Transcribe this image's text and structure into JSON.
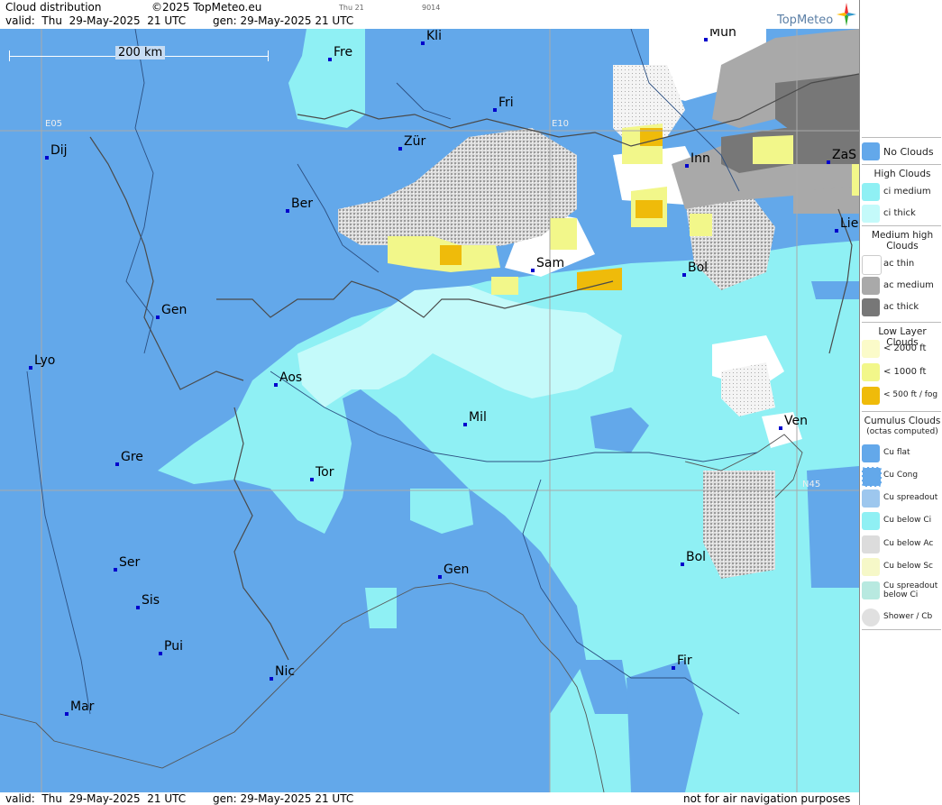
{
  "header": {
    "title": "Cloud distribution",
    "copyright": "©2025 TopMeteo.eu",
    "valid": "valid:  Thu  29-May-2025  21 UTC",
    "gen": "gen: 29-May-2025 21 UTC",
    "day_small": "Thu 21",
    "code_small": "9014",
    "logo": "TopMeteo"
  },
  "map": {
    "scale_label": "200 km",
    "grid_labels": {
      "e05": "E05",
      "e10": "E10",
      "n45": "N45"
    },
    "cities": [
      {
        "name": "Fre"
      },
      {
        "name": "Kli"
      },
      {
        "name": "Mün"
      },
      {
        "name": "Fri"
      },
      {
        "name": "Dij"
      },
      {
        "name": "Zür"
      },
      {
        "name": "Inn"
      },
      {
        "name": "ZaS"
      },
      {
        "name": "Ber"
      },
      {
        "name": "Lie"
      },
      {
        "name": "Sam"
      },
      {
        "name": "Bol"
      },
      {
        "name": "Gen"
      },
      {
        "name": "Lyo"
      },
      {
        "name": "Aos"
      },
      {
        "name": "Mil"
      },
      {
        "name": "Ven"
      },
      {
        "name": "Gre"
      },
      {
        "name": "Tor"
      },
      {
        "name": "Ser"
      },
      {
        "name": "Gen"
      },
      {
        "name": "Bol"
      },
      {
        "name": "Sis"
      },
      {
        "name": "Pui"
      },
      {
        "name": "Nic"
      },
      {
        "name": "Fir"
      },
      {
        "name": "Mar"
      }
    ]
  },
  "footer": {
    "valid": "valid:  Thu  29-May-2025  21 UTC",
    "gen": "gen: 29-May-2025 21 UTC",
    "note": "not for air navigation purposes"
  },
  "legend": {
    "no_clouds": "No Clouds",
    "high_head": "High Clouds",
    "ci_medium": "ci medium",
    "ci_thick": "ci thick",
    "medium_head": "Medium high Clouds",
    "ac_thin": "ac thin",
    "ac_medium": "ac medium",
    "ac_thick": "ac thick",
    "low_head": "Low Layer Clouds",
    "low_2000": "< 2000 ft",
    "low_1000": "< 1000 ft",
    "low_500": "< 500 ft / fog",
    "cu_head": "Cumulus Clouds",
    "cu_sub": "(octas computed)",
    "cu_flat": "Cu flat",
    "cu_cong": "Cu Cong",
    "cu_spread": "Cu spreadout",
    "cu_below_ci": "Cu below Ci",
    "cu_below_ac": "Cu below Ac",
    "cu_below_sc": "Cu below Sc",
    "cu_spread_ci": "Cu spreadout below Ci",
    "shower": "Shower / Cb",
    "colors": {
      "no_clouds": "#63a8ea",
      "ci_medium": "#8ff0f4",
      "ci_thick": "#c4fafa",
      "ac_thin": "#ffffff",
      "ac_medium": "#a9a9a9",
      "ac_thick": "#777777",
      "low_2000": "#fbfbc9",
      "low_1000": "#f2f78a",
      "low_500": "#efbb0a"
    }
  }
}
